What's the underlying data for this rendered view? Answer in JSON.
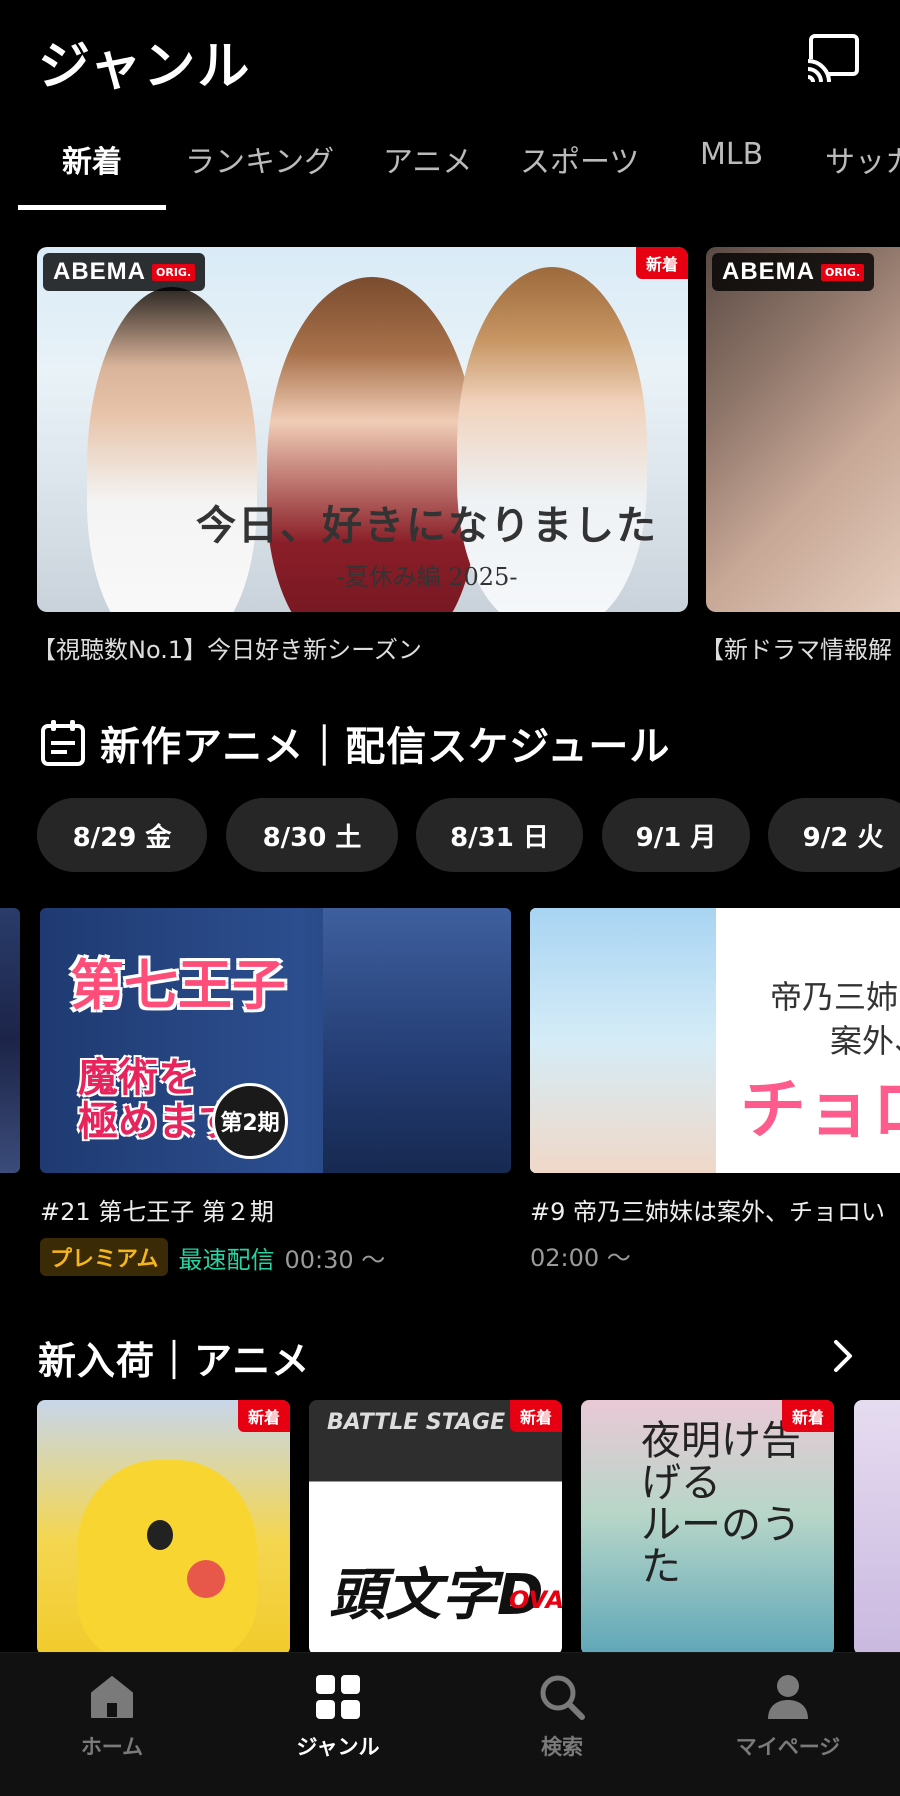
{
  "header": {
    "title": "ジャンル",
    "cast_icon": "cast-icon"
  },
  "tabs": [
    {
      "label": "新着"
    },
    {
      "label": "ランキング"
    },
    {
      "label": "アニメ"
    },
    {
      "label": "スポーツ"
    },
    {
      "label": "MLB"
    },
    {
      "label": "サッカ"
    }
  ],
  "active_tab": "新着",
  "hero": {
    "items": [
      {
        "badge": "ABEMA",
        "badge_tag": "ORIG.",
        "new_label": "新着",
        "logo_main": "今日、好きになりました",
        "logo_sub": "-夏休み編 2025-",
        "caption": "【視聴数No.1】今日好き新シーズン"
      },
      {
        "badge": "ABEMA",
        "badge_tag": "ORIG.",
        "caption": "【新ドラマ情報解"
      }
    ]
  },
  "schedule": {
    "title": "新作アニメ｜配信スケジュール",
    "icon": "calendar-icon",
    "dates": [
      "8/29 金",
      "8/30 土",
      "8/31 日",
      "9/1 月",
      "9/2 火"
    ],
    "cards": [
      {
        "art_title": "第七王子",
        "art_sub": "魔術を\n極めます",
        "art_circle": "第2期",
        "episode": "#21 第七王子 第２期",
        "premium": "プレミアム",
        "fast": "最速配信",
        "time": "00:30 〜"
      },
      {
        "art_line1": "帝乃三姉",
        "art_line2": "案外、",
        "art_line3": "チョロ",
        "episode": "#9 帝乃三姉妹は案外、チョロい",
        "time": "02:00 〜"
      }
    ]
  },
  "new_arrivals": {
    "title": "新入荷｜アニメ",
    "new_label": "新着",
    "tile2_top": "BATTLE STAGE",
    "tile2_main": "頭文字D",
    "tile2_tag": "OVA",
    "tile3_title": "夜明け告げる\nルーのうた"
  },
  "bottom_nav": [
    {
      "label": "ホーム",
      "icon": "home-icon"
    },
    {
      "label": "ジャンル",
      "icon": "grid-icon"
    },
    {
      "label": "検索",
      "icon": "search-icon"
    },
    {
      "label": "マイページ",
      "icon": "person-icon"
    }
  ],
  "active_nav": "ジャンル",
  "colors": {
    "accent_red": "#e60012",
    "premium_gold": "#f5b51c",
    "fast_green": "#26d3a3",
    "background": "#000000"
  }
}
